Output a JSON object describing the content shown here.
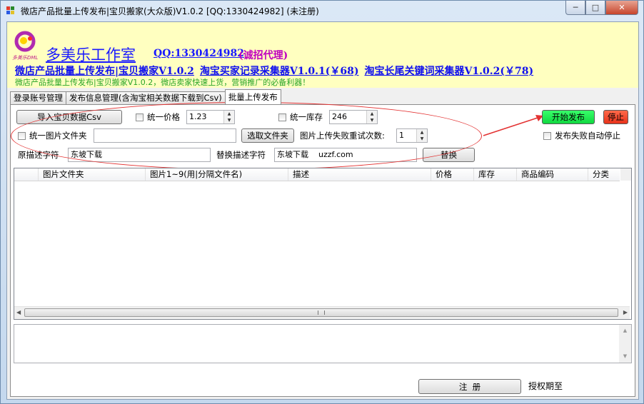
{
  "window": {
    "title": "微店产品批量上传发布|宝贝搬家(大众版)V1.0.2 [QQ:1330424982] (未注册)",
    "minimize_icon": "minimize-icon",
    "maximize_icon": "maximize-icon",
    "close_icon": "close-icon"
  },
  "banner": {
    "logo_text": "多美乐DML",
    "studio_name": "多美乐工作室",
    "qq": "QQ:1330424982",
    "recruit": "(诚招代理)",
    "links": [
      "微店产品批量上传发布|宝贝搬家V1.0.2",
      "淘宝买家记录采集器V1.0.1(￥68)",
      "淘宝长尾关键词采集器V1.0.2(￥78)"
    ],
    "slogan": "微店产品批量上传发布|宝贝搬家V1.0.2，微店卖家快速上货，营销推广的必备利器！"
  },
  "tabs": [
    {
      "label": "登录账号管理",
      "active": false
    },
    {
      "label": "发布信息管理(含淘宝相关数据下载到Csv)",
      "active": false
    },
    {
      "label": "批量上传发布",
      "active": true
    }
  ],
  "form": {
    "import_csv_button": "导入宝贝数据Csv",
    "unify_price_label": "统一价格",
    "unify_price_value": "1.23",
    "unify_stock_label": "统一库存",
    "unify_stock_value": "246",
    "unify_image_folder_label": "统一图片文件夹",
    "image_folder_value": "",
    "select_folder_button": "选取文件夹",
    "retry_label": "图片上传失败重试次数:",
    "retry_value": "1",
    "orig_desc_label": "原描述字符",
    "orig_desc_value": "东坡下载",
    "replace_desc_label": "替换描述字符",
    "replace_desc_value": "东坡下载    uzzf.com",
    "replace_button": "替换",
    "start_button": "开始发布",
    "stop_button": "停止",
    "auto_stop_label": "发布失败自动停止"
  },
  "grid": {
    "columns": [
      "图片文件夹",
      "图片1~9(用|分隔文件名)",
      "描述",
      "价格",
      "库存",
      "商品编码",
      "分类"
    ],
    "rows": []
  },
  "footer": {
    "register_button": "注  册",
    "expire_label": "授权期至"
  },
  "colors": {
    "start": "#10d840",
    "stop": "#e8321a",
    "banner_bg": "#ffffc0",
    "link": "#1010ee",
    "annotation": "#e33232"
  }
}
